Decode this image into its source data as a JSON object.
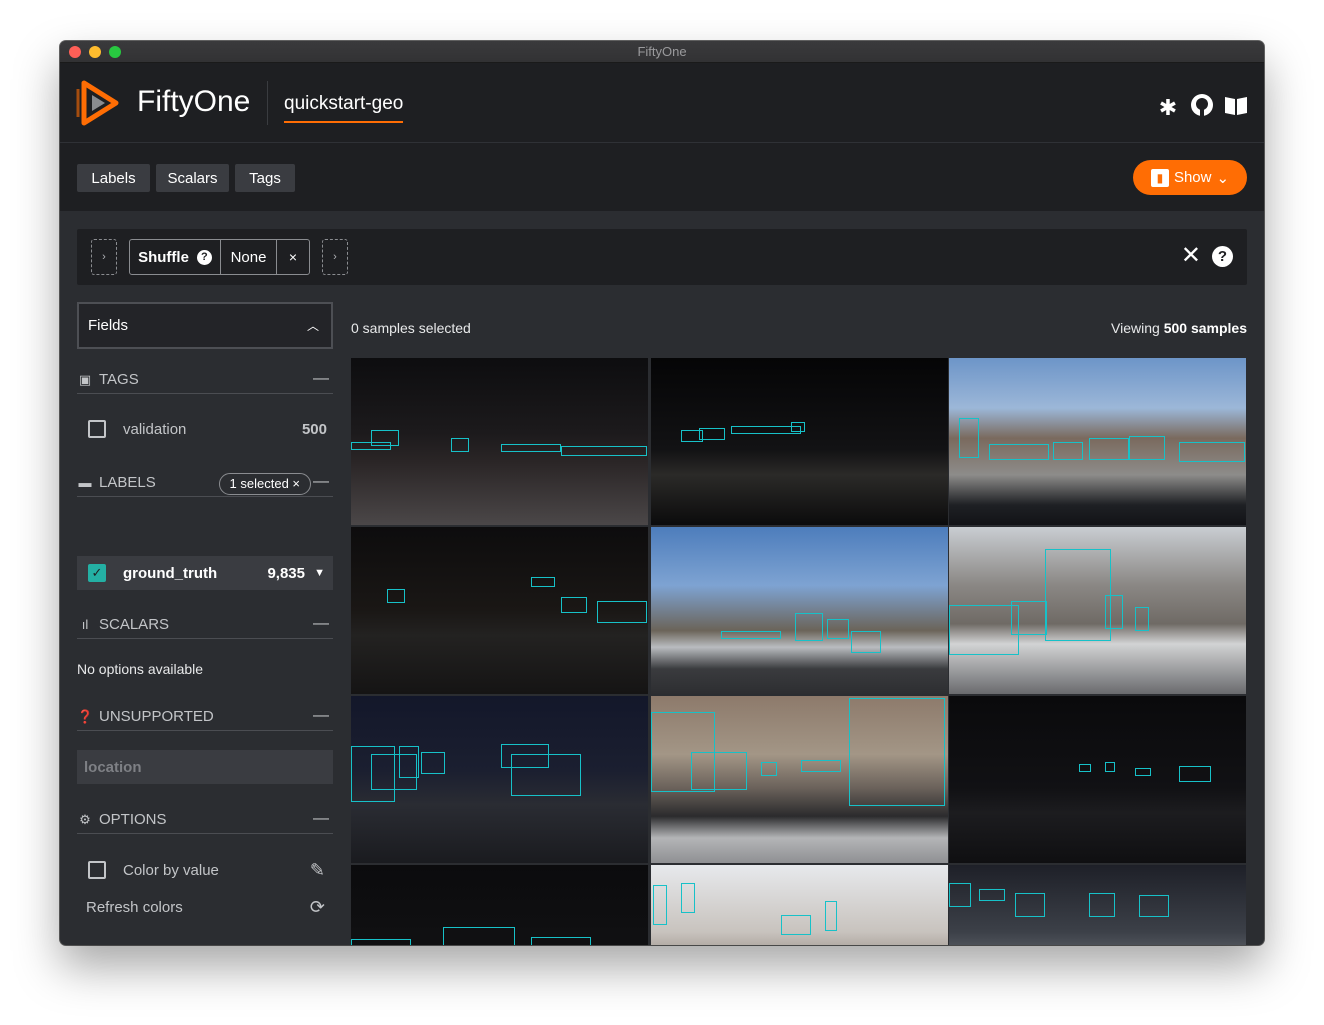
{
  "window": {
    "title": "FiftyOne"
  },
  "header": {
    "brand": "FiftyOne",
    "dataset": "quickstart-geo",
    "icons": [
      "slack-icon",
      "github-icon",
      "docs-book-icon"
    ]
  },
  "toolbar": {
    "tabs": [
      "Labels",
      "Scalars",
      "Tags"
    ],
    "show_label": "Show"
  },
  "view_bar": {
    "stage_name": "Shuffle",
    "stage_value": "None",
    "delete_glyph": "×",
    "add_glyph": "›",
    "close_glyph": "✕",
    "help_glyph": "?"
  },
  "sidebar": {
    "fields_label": "Fields",
    "tags": {
      "title": "TAGS",
      "items": [
        {
          "label": "validation",
          "count": "500",
          "checked": false
        }
      ]
    },
    "labels": {
      "title": "LABELS",
      "selected_pill": "1 selected ×",
      "items": [
        {
          "label": "ground_truth",
          "count": "9,835",
          "checked": true
        }
      ]
    },
    "scalars": {
      "title": "SCALARS",
      "empty_text": "No options available"
    },
    "unsupported": {
      "title": "UNSUPPORTED",
      "items": [
        "location"
      ]
    },
    "options": {
      "title": "OPTIONS",
      "color_by_value": "Color by value",
      "refresh_colors": "Refresh colors"
    }
  },
  "main": {
    "selected_text": "0 samples selected",
    "viewing_prefix": "Viewing ",
    "viewing_count": "500 samples"
  },
  "colors": {
    "accent": "#ff6d04",
    "bbox": "#17c1c8",
    "background": "#2b2d31",
    "header": "#1e1f22"
  }
}
